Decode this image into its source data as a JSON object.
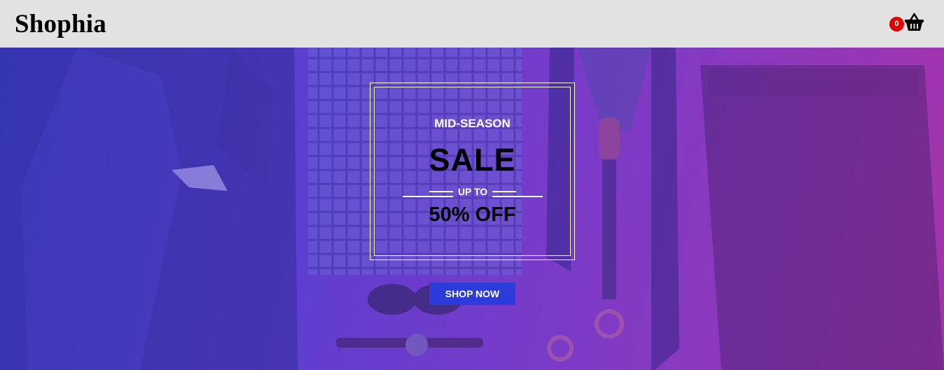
{
  "header": {
    "logo": "Shophia",
    "cart_count": "0",
    "cart_icon": "basket-icon"
  },
  "hero": {
    "kicker": "MID-SEASON",
    "headline": "SALE",
    "upto": "UP TO",
    "discount": "50% OFF",
    "cta_label": "SHOP NOW",
    "cta_color": "#2c3bd9",
    "overlay_colors": [
      "#3f3fcf",
      "#a434a8"
    ],
    "background_image": "menswear flat-lay (jacket, checked shirt, ties, suspenders, sunglasses, watch, trousers)"
  }
}
